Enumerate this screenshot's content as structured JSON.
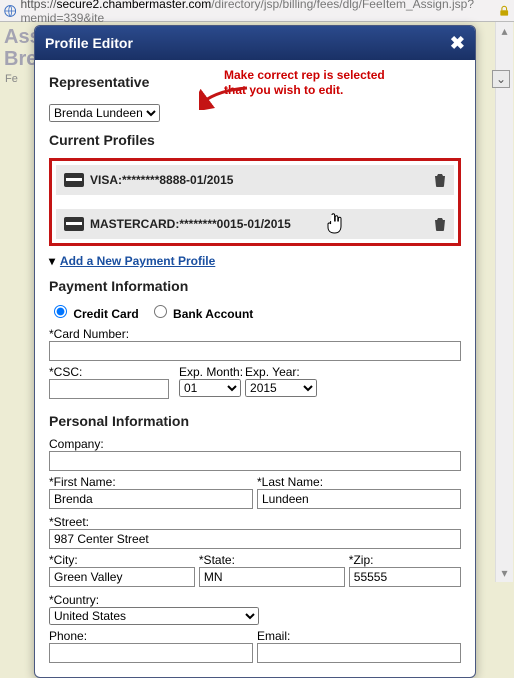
{
  "url": {
    "proto": "https://",
    "host": "secure2.chambermaster.com",
    "path": "/directory/jsp/billing/fees/dlg/FeeItem_Assign.jsp?memid=339&ite"
  },
  "background": {
    "title_line1": "Ass",
    "title_line2": "Bre",
    "fe_label": "Fe"
  },
  "modal": {
    "title": "Profile Editor",
    "close_glyph": "✖"
  },
  "representative": {
    "heading": "Representative",
    "help_line1": "Make correct rep is selected",
    "help_line2": "that you wish to edit.",
    "selected": "Brenda Lundeen"
  },
  "current_profiles": {
    "heading": "Current Profiles",
    "items": [
      {
        "text": "VISA:********8888-01/2015",
        "hand": false
      },
      {
        "text": "MASTERCARD:********0015-01/2015",
        "hand": true
      }
    ]
  },
  "add_link": {
    "caret": "▾",
    "label": "Add a New Payment Profile"
  },
  "payment_info": {
    "heading": "Payment Information",
    "credit_card_label": "Credit Card",
    "bank_account_label": "Bank Account",
    "card_number_label": "*Card Number:",
    "card_number_value": "",
    "csc_label": "*CSC:",
    "csc_value": "",
    "exp_month_label": "Exp. Month:",
    "exp_month_value": "01",
    "exp_year_label": "Exp. Year:",
    "exp_year_value": "2015"
  },
  "personal_info": {
    "heading": "Personal Information",
    "company_label": "Company:",
    "company_value": "",
    "first_name_label": "*First Name:",
    "first_name_value": "Brenda",
    "last_name_label": "*Last Name:",
    "last_name_value": "Lundeen",
    "street_label": "*Street:",
    "street_value": "987 Center Street",
    "city_label": "*City:",
    "city_value": "Green Valley",
    "state_label": "*State:",
    "state_value": "MN",
    "zip_label": "*Zip:",
    "zip_value": "55555",
    "country_label": "*Country:",
    "country_value": "United States",
    "phone_label": "Phone:",
    "phone_value": "",
    "email_label": "Email:",
    "email_value": ""
  }
}
